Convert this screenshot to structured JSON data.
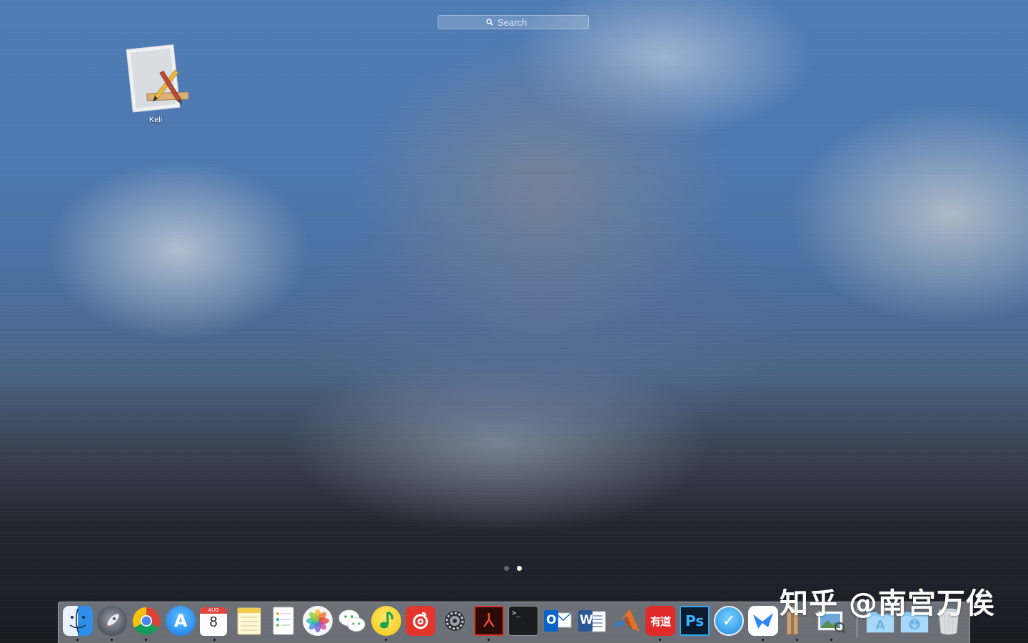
{
  "search": {
    "placeholder": "Search"
  },
  "launchpad_apps": [
    {
      "label": "Keli",
      "icon": "xcode-pencil-ruler-icon"
    }
  ],
  "pages": {
    "count": 2,
    "current": 2
  },
  "calendar": {
    "month": "AUG",
    "day": "8"
  },
  "dock_apps": [
    {
      "name": "Finder",
      "icon": "finder-icon",
      "running": true
    },
    {
      "name": "Launchpad",
      "icon": "rocket-icon",
      "running": true
    },
    {
      "name": "Chrome",
      "icon": "chrome-icon",
      "running": true
    },
    {
      "name": "App Store",
      "icon": "app-store-icon",
      "running": false
    },
    {
      "name": "Calendar",
      "icon": "calendar-icon",
      "running": true
    },
    {
      "name": "Notes",
      "icon": "notes-icon",
      "running": false
    },
    {
      "name": "Reminders",
      "icon": "reminders-icon",
      "running": false
    },
    {
      "name": "Photos",
      "icon": "photos-icon",
      "running": false
    },
    {
      "name": "WeChat",
      "icon": "wechat-icon",
      "running": false
    },
    {
      "name": "QQ Music",
      "icon": "music-note-icon",
      "running": true
    },
    {
      "name": "NetEase Music",
      "icon": "netease-music-icon",
      "running": false
    },
    {
      "name": "System Preferences",
      "icon": "gear-icon",
      "running": false
    },
    {
      "name": "Adobe Acrobat",
      "icon": "acrobat-icon",
      "running": true
    },
    {
      "name": "Terminal",
      "icon": "terminal-icon",
      "running": false
    },
    {
      "name": "Outlook",
      "icon": "outlook-icon",
      "running": false
    },
    {
      "name": "Word",
      "icon": "word-icon",
      "running": false
    },
    {
      "name": "MATLAB",
      "icon": "matlab-icon",
      "running": false
    },
    {
      "name": "Youdao Dictionary",
      "icon": "youdao-icon",
      "running": true
    },
    {
      "name": "Photoshop",
      "icon": "photoshop-icon",
      "running": false
    },
    {
      "name": "Tasks",
      "icon": "checkmark-icon",
      "running": false
    },
    {
      "name": "Feishu",
      "icon": "bird-icon",
      "running": true
    },
    {
      "name": "Archive Utility",
      "icon": "archive-icon",
      "running": true
    },
    {
      "name": "Preview",
      "icon": "preview-icon",
      "running": true
    },
    {
      "name": "Applications",
      "icon": "applications-folder-icon",
      "running": false
    },
    {
      "name": "Downloads",
      "icon": "downloads-folder-icon",
      "running": false
    },
    {
      "name": "Trash",
      "icon": "trash-icon",
      "running": false
    }
  ],
  "glyphs": {
    "acrobat": "⅄",
    "terminal": ">_",
    "outlook": "O",
    "word": "W",
    "youdao": "有道",
    "photoshop": "Ps",
    "checkmark": "✓",
    "app_store": "A"
  },
  "watermark": "知乎 @南宫万俟"
}
